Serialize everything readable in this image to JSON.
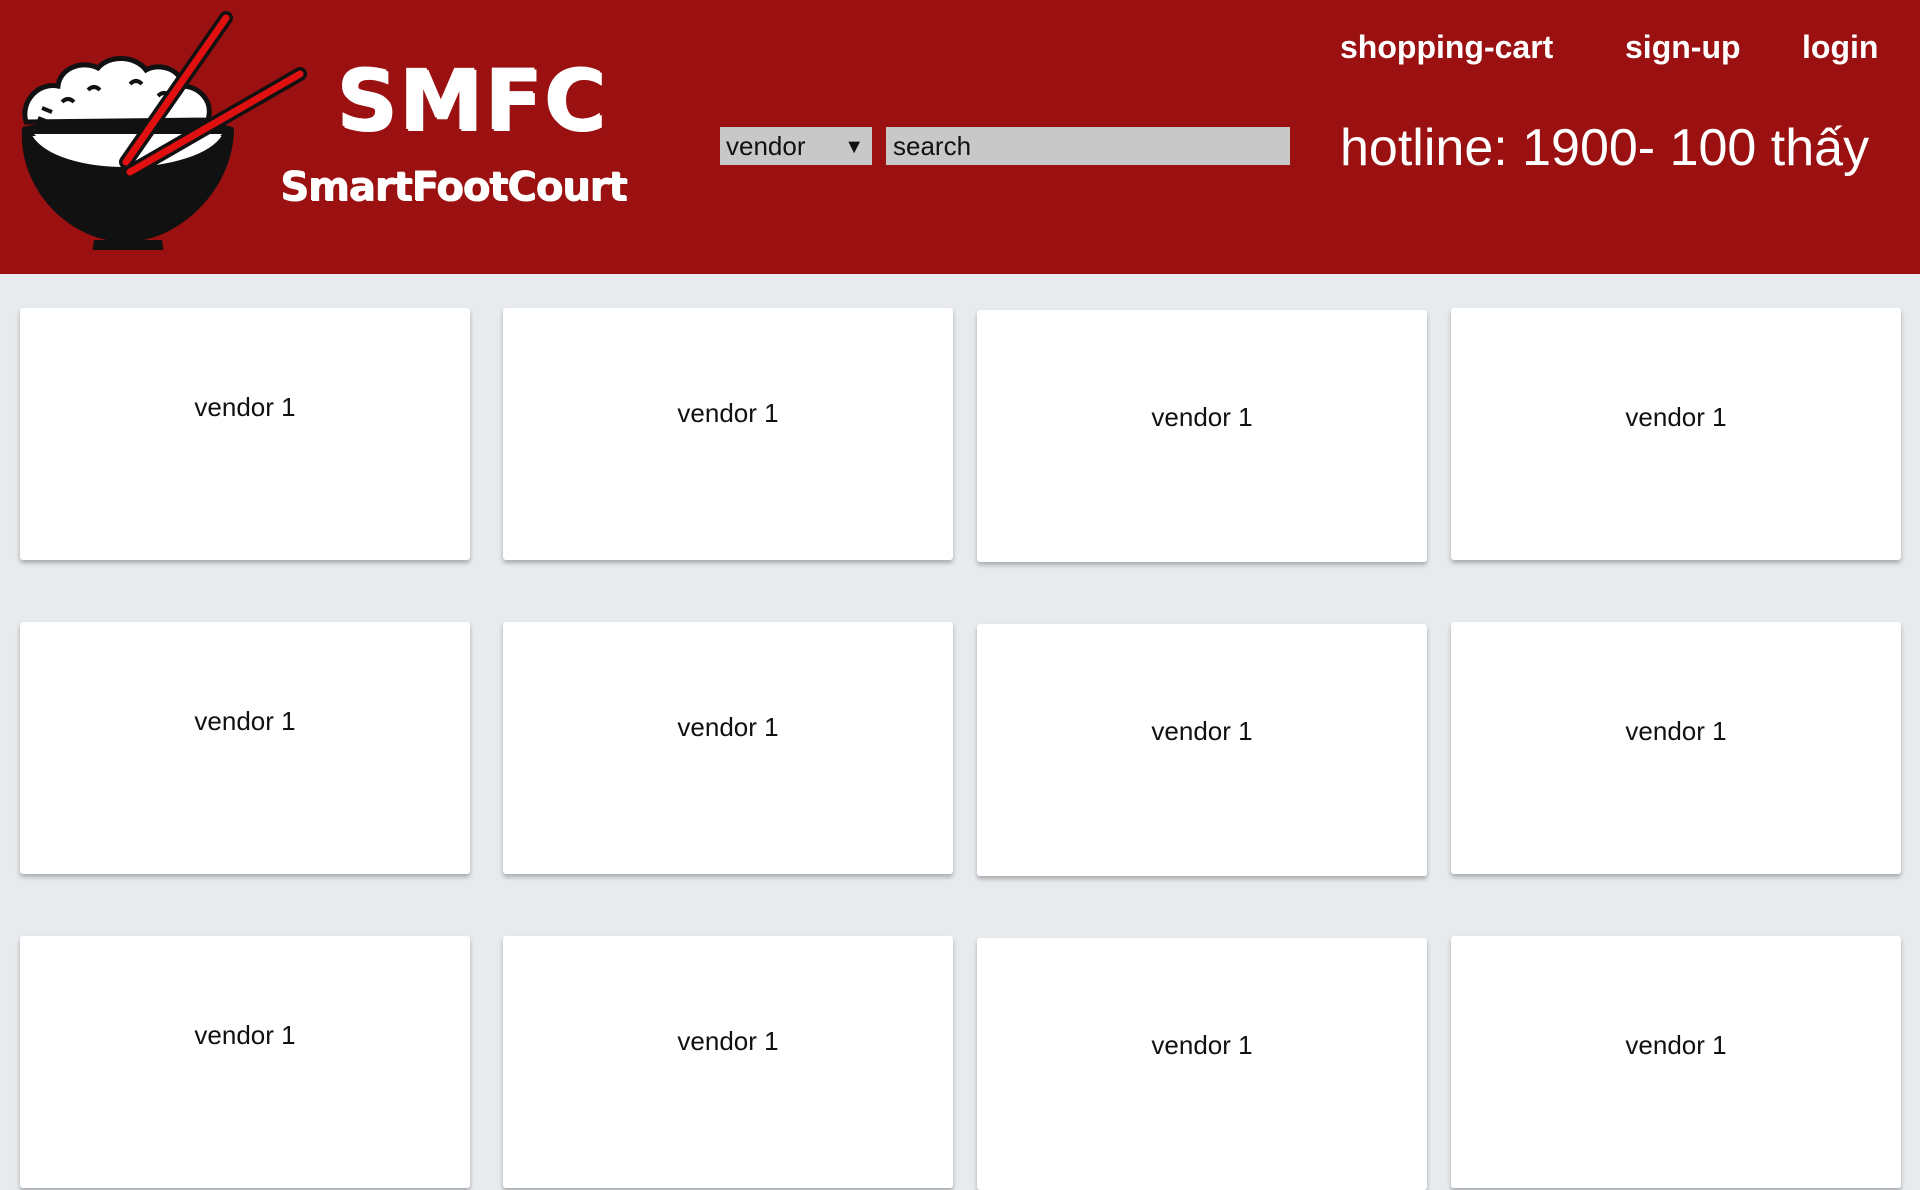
{
  "header": {
    "brand_title": "SMFC",
    "brand_subtitle": "SmartFootCourt",
    "search": {
      "category_selected": "vendor",
      "placeholder": "search"
    },
    "nav": {
      "shopping_cart": "shopping-cart",
      "sign_up": "sign-up",
      "login": "login"
    },
    "hotline": "hotline: 1900- 100 thấy"
  },
  "vendors": [
    {
      "label": "vendor 1"
    },
    {
      "label": "vendor 1"
    },
    {
      "label": "vendor 1"
    },
    {
      "label": "vendor 1"
    },
    {
      "label": "vendor 1"
    },
    {
      "label": "vendor 1"
    },
    {
      "label": "vendor 1"
    },
    {
      "label": "vendor 1"
    },
    {
      "label": "vendor 1"
    },
    {
      "label": "vendor 1"
    },
    {
      "label": "vendor 1"
    },
    {
      "label": "vendor 1"
    }
  ],
  "colors": {
    "header_bg": "#9b1111",
    "page_bg": "#e8ebee",
    "card_bg": "#ffffff",
    "input_bg": "#c8c8c8",
    "chopstick": "#e01010"
  },
  "icons": {
    "logo": "rice-bowl-chopsticks-icon",
    "select_arrow": "chevron-down-icon"
  }
}
